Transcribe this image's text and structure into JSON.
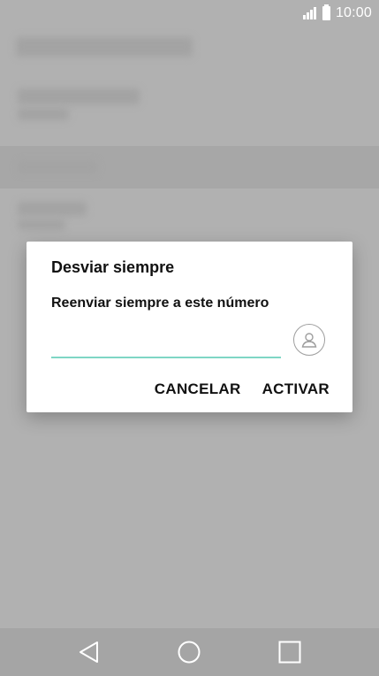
{
  "status_bar": {
    "time": "10:00",
    "icons": [
      "signal-icon",
      "battery-icon"
    ]
  },
  "dialog": {
    "title": "Desviar siempre",
    "subtitle": "Reenviar siempre a este número",
    "input": {
      "value": "",
      "placeholder": ""
    },
    "contact_icon": "contact-icon",
    "accent_color": "#7fd6c5",
    "actions": {
      "cancel_label": "CANCELAR",
      "confirm_label": "ACTIVAR"
    }
  },
  "navbar": {
    "icons": [
      "back-icon",
      "home-icon",
      "recents-icon"
    ]
  }
}
